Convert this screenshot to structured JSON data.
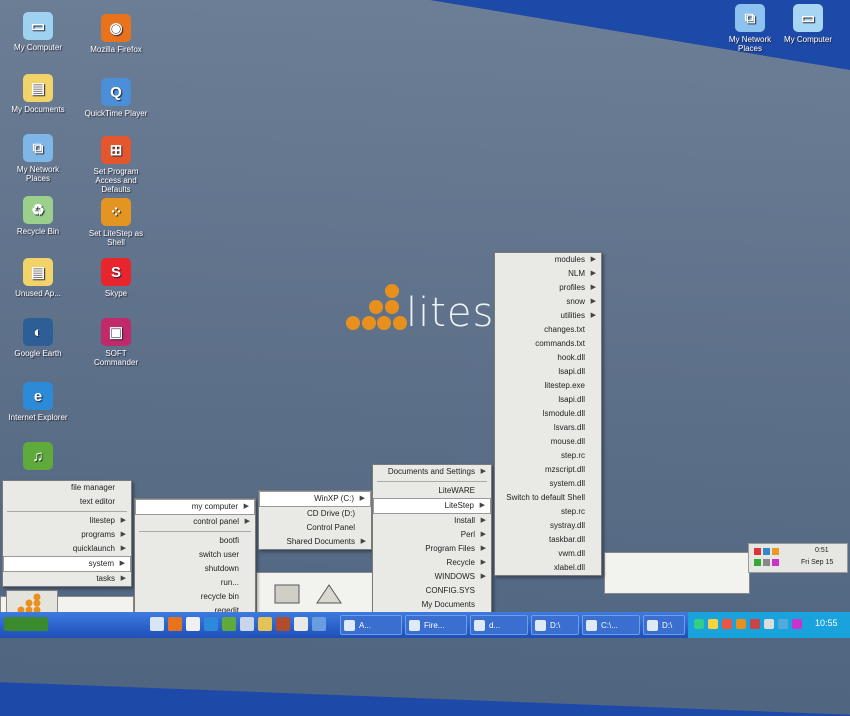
{
  "desktop_icons": [
    {
      "label": "My Computer",
      "icon": "computer-icon",
      "color": "#9fd1f0"
    },
    {
      "label": "Mozilla Firefox",
      "icon": "firefox-icon",
      "color": "#e8731c"
    },
    {
      "label": "My Documents",
      "icon": "folder-documents-icon",
      "color": "#f2d36a"
    },
    {
      "label": "QuickTime Player",
      "icon": "quicktime-icon",
      "color": "#4a8fd8"
    },
    {
      "label": "My Network Places",
      "icon": "network-icon",
      "color": "#7fb6e8"
    },
    {
      "label": "Set Program Access and Defaults",
      "icon": "windows-logo-icon",
      "color": "#e4572e"
    },
    {
      "label": "Recycle Bin",
      "icon": "recycle-bin-icon",
      "color": "#9ad08c"
    },
    {
      "label": "Set LiteStep as Shell",
      "icon": "litestep-icon",
      "color": "#e39421"
    },
    {
      "label": "Unused Ap...",
      "icon": "folder-icon",
      "color": "#f2d36a"
    },
    {
      "label": "Skype",
      "icon": "skype-icon",
      "color": "#e8242c"
    },
    {
      "label": "Google Earth",
      "icon": "google-earth-icon",
      "color": "#2d5e96"
    },
    {
      "label": "SOFT Commander",
      "icon": "floppy-icon",
      "color": "#c02a6a"
    },
    {
      "label": "Internet Explorer",
      "icon": "ie-icon",
      "color": "#2d8ad8"
    },
    {
      "label": "",
      "icon": "winamp-icon",
      "color": "#5faa3a"
    }
  ],
  "top_right_icons": [
    {
      "label": "My Network Places",
      "icon": "network-icon"
    },
    {
      "label": "My Computer",
      "icon": "computer-icon"
    }
  ],
  "logo": {
    "text": "lites",
    "color": "#e8901d"
  },
  "main_menu": {
    "items": [
      "file manager",
      "text editor",
      "litestep",
      "programs",
      "quicklaunch",
      "system",
      "tasks"
    ],
    "submenu_flags": [
      false,
      false,
      true,
      true,
      true,
      true,
      true
    ]
  },
  "system_menu": {
    "items": [
      "my computer",
      "control panel",
      "bootfi",
      "switch user",
      "shutdown",
      "run...",
      "recycle bin",
      "regedit"
    ],
    "submenu_flags": [
      true,
      true,
      false,
      false,
      false,
      false,
      false,
      false
    ]
  },
  "computer_menu": {
    "items": [
      "WinXP (C:)",
      "CD Drive (D:)",
      "Control Panel",
      "Shared Documents"
    ],
    "submenu_flags": [
      true,
      false,
      false,
      true
    ]
  },
  "drive_menu": {
    "items": [
      "Documents and Settings",
      "LiteWARE",
      "LiteStep",
      "Install",
      "Perl",
      "Program Files",
      "Recycle",
      "WINDOWS",
      "CONFIG.SYS",
      "My Documents"
    ],
    "submenu_flags": [
      true,
      false,
      true,
      true,
      true,
      true,
      true,
      true,
      false,
      false
    ]
  },
  "litestep_menu": {
    "items": [
      "modules",
      "NLM",
      "profiles",
      "snow",
      "utilities",
      "changes.txt",
      "commands.txt",
      "hook.dll",
      "lsapi.dll",
      "litestep.exe",
      "lsapi.dll",
      "lsmodule.dll",
      "lsvars.dll",
      "mouse.dll",
      "step.rc",
      "mzscript.dll",
      "system.dll",
      "Switch to default Shell",
      "step.rc",
      "systray.dll",
      "taskbar.dll",
      "vwm.dll",
      "xlabel.dll"
    ],
    "submenu_flags": [
      true,
      true,
      true,
      true,
      true,
      false,
      false,
      false,
      false,
      false,
      false,
      false,
      false,
      false,
      false,
      false,
      false,
      false,
      false,
      false,
      false,
      false,
      false
    ]
  },
  "taskbar": {
    "buttons": [
      "A...",
      "Fire...",
      "d...",
      "D:\\",
      "C:\\...",
      "D:\\"
    ],
    "clock": "10:55"
  },
  "sysbox": {
    "time": "0:51",
    "date": "Fri Sep 15"
  },
  "colors": {
    "taskbar": "#2a5fc8",
    "wallpaper": "#5d7089",
    "tray": "#1aa2dc"
  }
}
